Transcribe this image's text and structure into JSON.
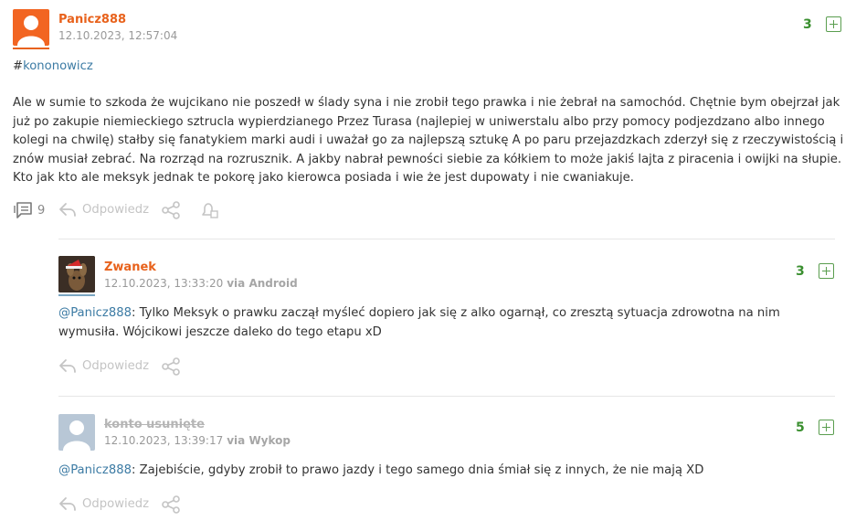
{
  "comments": [
    {
      "username": "Panicz888",
      "timestamp": "12.10.2023, 12:57:04",
      "votes": "3",
      "hashtag_prefix": "#",
      "hashtag": "kononowicz",
      "body_lines": [
        "Ale w sumie to szkoda że wujcikano nie poszedł w ślady syna i nie zrobił tego prawka i nie żebrał na samochód. Chętnie bym obejrzał jak",
        "już po zakupie niemieckiego sztrucla wypierdzianego Przez Turasa (najlepiej w uniwerstalu albo przy pomocy podjezdzano albo innego",
        "kolegi na chwilę) stałby się fanatykiem marki audi i uważał go za najlepszą sztukę A po paru przejazdzkach zderzył się z rzeczywistością i",
        "znów musiał zebrać. Na rozrząd na rozrusznik. A jakby nabrał pewności siebie za kółkiem to może jakiś lajta z piracenia i owijki na słupie.",
        "Kto jak kto ale meksyk jednak te pokorę jako kierowca posiada i wie że jest dupowaty i nie cwaniakuje."
      ],
      "comment_count": "9",
      "reply_label": "Odpowiedz",
      "avatar_color": "#f26522"
    },
    {
      "username": "Zwanek",
      "timestamp": "12.10.2023, 13:33:20",
      "via": "via Android",
      "votes": "3",
      "mention": "@Panicz888",
      "body_first": ": Tylko Meksyk o prawku zaczął myśleć dopiero jak się z alko ogarnął, co zresztą sytuacja zdrowotna na nim",
      "body_second": "wymusiła. Wójcikowi jeszcze daleko do tego etapu xD",
      "reply_label": "Odpowiedz"
    },
    {
      "username": "konto usunięte",
      "timestamp": "12.10.2023, 13:39:17",
      "via": "via Wykop",
      "votes": "5",
      "mention": "@Panicz888",
      "body_first": ": Zajebiście, gdyby zrobił to prawo jazdy i tego samego dnia śmiał się z innych, że nie mają XD",
      "reply_label": "Odpowiedz"
    }
  ],
  "colors": {
    "accent_orange": "#e8621c",
    "vote_green": "#3a8f2f",
    "link_blue": "#3c7ba4"
  }
}
